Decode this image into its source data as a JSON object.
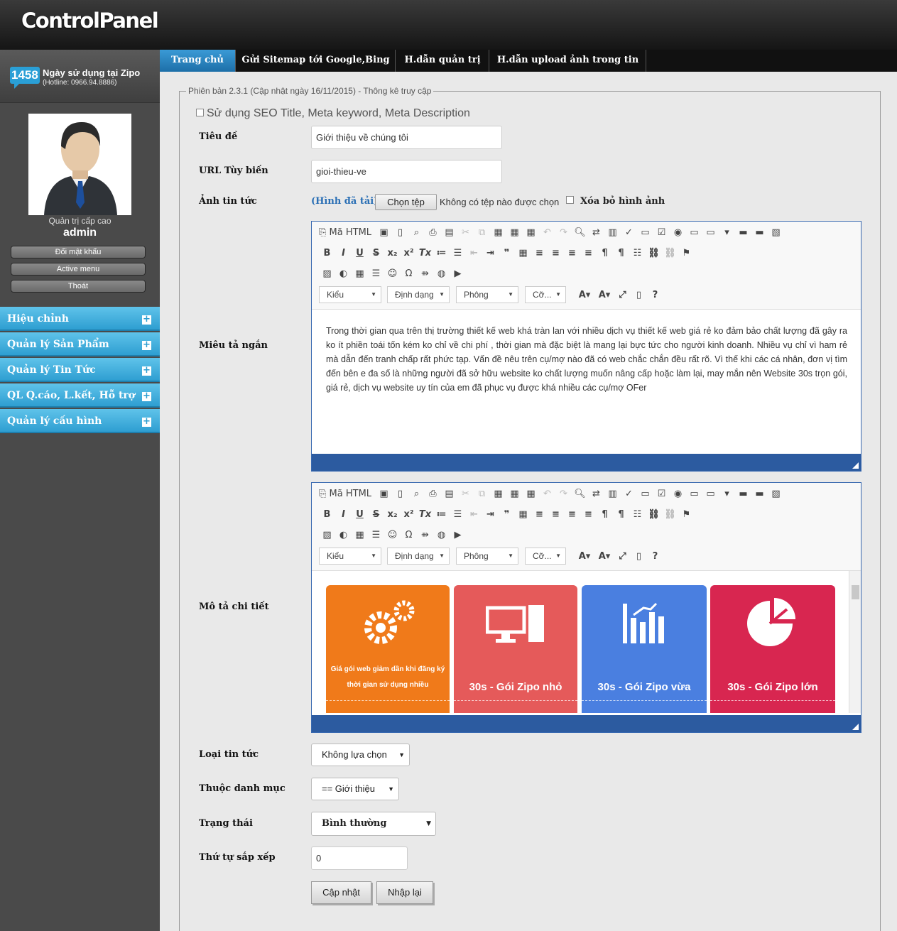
{
  "header": {
    "logo": "ControlPanel"
  },
  "sidebar": {
    "days_count": "1458",
    "days_text": "Ngày sử dụng tại Zipo",
    "hotline": "(Hotline: 0966.94.8886)",
    "role": "Quản trị cấp cao",
    "username": "admin",
    "buttons": {
      "change_password": "Đổi mật khẩu",
      "active_menu": "Active menu",
      "logout": "Thoát"
    },
    "menu": [
      "Hiệu chỉnh",
      "Quản lý Sản Phẩm",
      "Quản lý Tin Tức",
      "QL Q.cáo, L.kết, Hỗ trợ",
      "Quản lý cấu hình"
    ]
  },
  "tabs": [
    "Trang chủ",
    "Gửi Sitemap tới Google,Bing",
    "H.dẫn quản trị",
    "H.dẫn upload ảnh trong tin"
  ],
  "form": {
    "legend": "Phiên bản 2.3.1 (Cập nhật ngày 16/11/2015) - Thông kê truy cập",
    "seo_checkbox": "Sử dụng SEO Title, Meta keyword, Meta Description",
    "title_label": "Tiêu đề",
    "title_value": "Giới thiệu về chúng tôi",
    "url_label": "URL Tùy biến",
    "url_value": "gioi-thieu-ve",
    "image_label": "Ảnh tin tức",
    "image_link": "(Hình đã tải)",
    "choose_file": "Chọn tệp",
    "no_file": "Không có tệp nào được chọn",
    "delete_image": "Xóa bỏ hình ảnh",
    "short_desc_label": "Miêu tả ngắn",
    "detail_label": "Mô tả chi tiết",
    "short_desc_text": "Trong thời gian qua trên thị trường thiết kế web khá tràn lan với nhiều dịch vụ thiết kế web giá rẻ ko đảm bảo chất lượng đã gây ra ko ít phiền toái tốn kém ko chỉ về chi phí , thời gian mà đặc biệt là mang lại bực tức cho người kinh doanh. Nhiều vụ chỉ vì ham rẻ mà dẫn đến tranh chấp rất phức tạp. Vấn đề nêu trên cụ/mợ nào đã có web chắc chắn đều rất rõ. Vì thế khi các cá nhân, đơn vị tìm đến bên e đa số là những người đã sở hữu website ko chất lượng muốn nâng cấp hoặc làm lại, may mắn nên Website 30s trọn gói, giá rẻ, dịch vụ website uy tín của em đã phục vụ được khá nhiều các cụ/mợ OFer",
    "news_type_label": "Loại tin tức",
    "news_type_value": "Không lựa chọn",
    "category_label": "Thuộc danh mục",
    "category_value": "== Giới thiệu",
    "status_label": "Trạng thái",
    "status_value": "Bình thường",
    "order_label": "Thứ tự sắp xếp",
    "order_value": "0",
    "update_button": "Cập nhật",
    "reset_button": "Nhập lại"
  },
  "editor": {
    "source_label": "Mã HTML",
    "style_combo": "Kiểu",
    "format_combo": "Định dạng",
    "font_combo": "Phông",
    "size_combo": "Cỡ..."
  },
  "cards": [
    {
      "title": "Giá gói web giảm dần khi đăng ký thời gian sử dụng nhiều",
      "color": "#f07a1a"
    },
    {
      "title": "30s - Gói Zipo nhỏ",
      "color": "#e55a5a"
    },
    {
      "title": "30s - Gói Zipo vừa",
      "color": "#4a7fe0"
    },
    {
      "title": "30s - Gói Zipo lớn",
      "color": "#d82650"
    }
  ]
}
